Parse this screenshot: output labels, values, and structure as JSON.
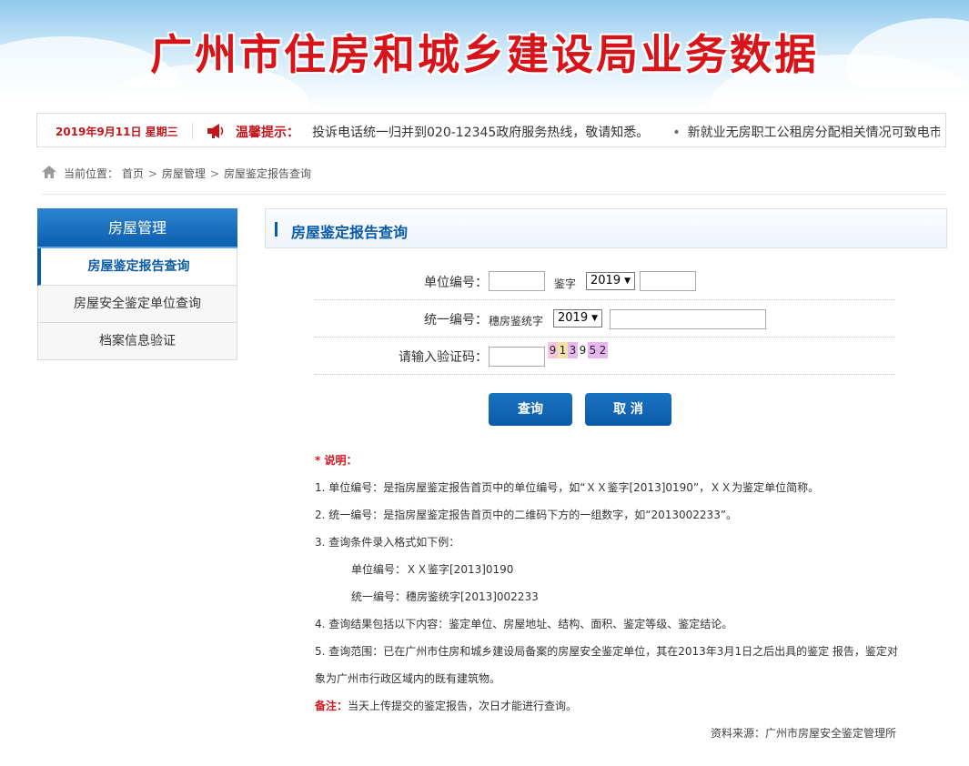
{
  "header": {
    "title": "广州市住房和城乡建设局业务数据"
  },
  "notice": {
    "date": "2019年9月11日 星期三",
    "label": "温馨提示：",
    "messages": [
      "投诉电话统一归并到020-12345政府服务热线，敬请知悉。",
      "新就业无房职工公租房分配相关情况可致电市"
    ],
    "icon": "horn-icon"
  },
  "breadcrumb": {
    "prefix": "当前位置：",
    "items": [
      "首页",
      "房屋管理",
      "房屋鉴定报告查询"
    ]
  },
  "sidebar": {
    "title": "房屋管理",
    "items": [
      {
        "label": "房屋鉴定报告查询",
        "active": true
      },
      {
        "label": "房屋安全鉴定单位查询",
        "active": false
      },
      {
        "label": "档案信息验证",
        "active": false
      }
    ]
  },
  "panel": {
    "title": "房屋鉴定报告查询"
  },
  "form": {
    "unit_label": "单位编号：",
    "unit_value": "",
    "jianzi": "鉴字",
    "unit_year": "2019",
    "unit_number": "",
    "unified_label": "统一编号：",
    "unified_prefix": "穗房鉴统字",
    "unified_year": "2019",
    "unified_number": "",
    "captcha_label": "请输入验证码：",
    "captcha_value": "",
    "captcha_chars": [
      "9",
      "1",
      "3",
      "9",
      "5",
      "2"
    ],
    "captcha_colors": [
      "#f6c6de",
      "#f3e3a6",
      "#e6b7ef",
      "#ffffff",
      "#e6b7ef",
      "#e6b7ef"
    ],
    "query_label": "查询",
    "cancel_label": "取 消"
  },
  "notes": {
    "heading": "* 说明：",
    "lines": [
      "1. 单位编号：是指房屋鉴定报告首页中的单位编号，如“ＸＸ鉴字[2013]0190”，ＸＸ为鉴定单位简称。",
      "2. 统一编号：是指房屋鉴定报告首页中的二维码下方的一组数字，如“2013002233”。",
      "3. 查询条件录入格式如下例：",
      "单位编号：ＸＸ鉴字[2013]0190",
      "统一编号：穗房鉴统字[2013]002233",
      "4. 查询结果包括以下内容：鉴定单位、房屋地址、结构、面积、鉴定等级、鉴定结论。",
      "5. 查询范围：已在广州市住房和城乡建设局备案的房屋安全鉴定单位，其在2013年3月1日之后出具的鉴定 报告，鉴定对",
      "象为广州市行政区域内的既有建筑物。"
    ],
    "remark_label": "备注：",
    "remark_text": "当天上传提交的鉴定报告，次日才能进行查询。",
    "source": "资料来源：广州市房屋安全鉴定管理所"
  },
  "colors": {
    "brand_blue": "#0a5ba6",
    "title_red": "#d8141b"
  }
}
